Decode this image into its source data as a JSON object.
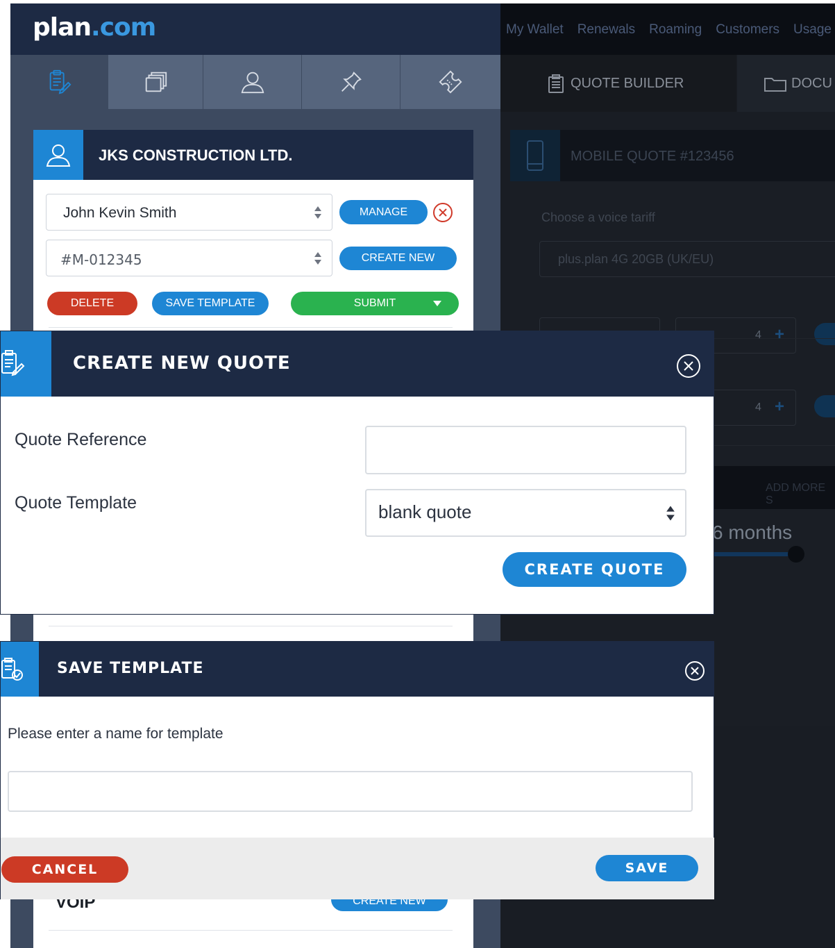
{
  "brand": {
    "name": "plan",
    "tld": ".com"
  },
  "topnav": [
    "My Wallet",
    "Renewals",
    "Roaming",
    "Customers",
    "Usage"
  ],
  "sidebar_tabs": [
    {
      "icon": "clipboard-edit-icon",
      "active": true
    },
    {
      "icon": "documents-icon",
      "active": false
    },
    {
      "icon": "user-icon",
      "active": false
    },
    {
      "icon": "pin-icon",
      "active": false
    },
    {
      "icon": "ticket-icon",
      "active": false
    }
  ],
  "customer": {
    "company": "JKS CONSTRUCTION LTD.",
    "contact": "John Kevin Smith",
    "account": "#M-012345",
    "manage_label": "MANAGE",
    "create_new_label": "CREATE NEW",
    "delete_label": "DELETE",
    "save_template_label": "SAVE TEMPLATE",
    "submit_label": "SUBMIT",
    "voip_label": "VOIP",
    "voip_create_label": "CREATE NEW"
  },
  "builder": {
    "tabs": [
      {
        "label": "QUOTE BUILDER",
        "icon": "clipboard-icon"
      },
      {
        "label": "DOCU",
        "icon": "folder-icon"
      }
    ],
    "quote_title": "MOBILE QUOTE #123456",
    "tariff_label": "Choose a voice tariff",
    "tariff_value": "plus.plan 4G 20GB (UK/EU)",
    "qty1": "4",
    "qty2": "4",
    "add_more_label": "ADD MORE S",
    "months_label": "6 months"
  },
  "create_quote_modal": {
    "title": "CREATE NEW QUOTE",
    "ref_label": "Quote Reference",
    "ref_value": "",
    "template_label": "Quote Template",
    "template_value": "blank quote",
    "create_label": "CREATE QUOTE"
  },
  "save_template_modal": {
    "title": "SAVE TEMPLATE",
    "prompt": "Please enter a name for template",
    "name_value": "",
    "cancel_label": "CANCEL",
    "save_label": "SAVE"
  },
  "colors": {
    "navy": "#1d2a44",
    "accent_blue": "#1e86d4",
    "danger_red": "#cc3a25",
    "success_green": "#2ab24f"
  }
}
